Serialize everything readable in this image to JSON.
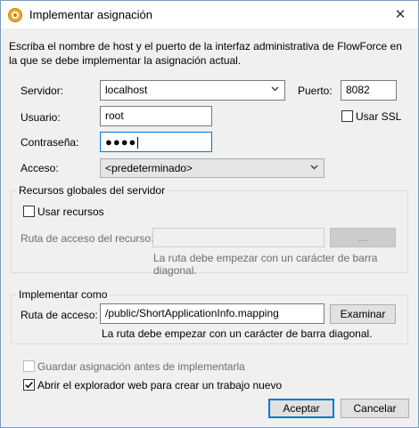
{
  "title": "Implementar asignación",
  "close": "✕",
  "description": "Escriba el nombre de host y el puerto de la interfaz administrativa de FlowForce en la que se debe implementar la asignación actual.",
  "server": {
    "label": "Servidor:",
    "value": "localhost"
  },
  "port": {
    "label": "Puerto:",
    "value": "8082"
  },
  "ssl": {
    "label": "Usar SSL",
    "checked": false
  },
  "user": {
    "label": "Usuario:",
    "value": "root"
  },
  "password": {
    "label": "Contraseña:",
    "dots": "●●●●"
  },
  "access": {
    "label": "Acceso:",
    "value": "<predeterminado>"
  },
  "global_resources": {
    "title": "Recursos globales del servidor",
    "use_label": "Usar recursos",
    "use_checked": false,
    "path_label": "Ruta de acceso del recurso:",
    "path_value": "",
    "browse_label": "...",
    "hint": "La ruta debe empezar con un carácter de barra diagonal."
  },
  "deploy_as": {
    "title": "Implementar como",
    "path_label": "Ruta de acceso:",
    "path_value": "/public/ShortApplicationInfo.mapping",
    "browse_label": "Examinar",
    "hint": "La ruta debe empezar con un carácter de barra diagonal."
  },
  "save_before": {
    "label": "Guardar asignación antes de implementarla",
    "checked": false,
    "disabled": true
  },
  "open_browser": {
    "label": "Abrir el explorador web para crear un trabajo nuevo",
    "checked": true
  },
  "buttons": {
    "ok": "Aceptar",
    "cancel": "Cancelar"
  },
  "colors": {
    "focus": "#0078d7",
    "dialog_bg": "#f0f0f0",
    "disabled_text": "#6d6d6d"
  },
  "icons": {
    "app": "mapforce-app-icon",
    "chevron": "chevron-down-icon",
    "check": "checkmark-icon"
  }
}
